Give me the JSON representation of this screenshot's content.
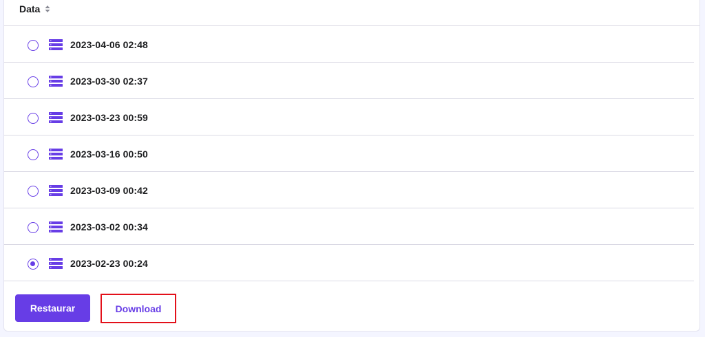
{
  "table": {
    "column_header": "Data",
    "sort_icon": "sort-icon",
    "row_icon": "server-icon",
    "rows": [
      {
        "date": "2023-04-06 02:48",
        "selected": false
      },
      {
        "date": "2023-03-30 02:37",
        "selected": false
      },
      {
        "date": "2023-03-23 00:59",
        "selected": false
      },
      {
        "date": "2023-03-16 00:50",
        "selected": false
      },
      {
        "date": "2023-03-09 00:42",
        "selected": false
      },
      {
        "date": "2023-03-02 00:34",
        "selected": false
      },
      {
        "date": "2023-02-23 00:24",
        "selected": true
      }
    ]
  },
  "actions": {
    "restore_label": "Restaurar",
    "download_label": "Download"
  },
  "colors": {
    "accent": "#673de6",
    "highlight_border": "#e3101a",
    "text": "#1d1e20",
    "divider": "#dad9e4"
  }
}
